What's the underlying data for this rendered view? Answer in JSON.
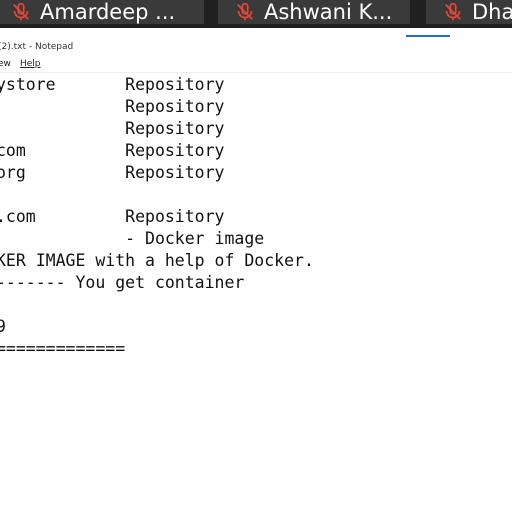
{
  "taskbar": {
    "tiles": [
      {
        "name": "Amardeep ..."
      },
      {
        "name": "Ashwani K..."
      },
      {
        "name": "Dha"
      }
    ],
    "accent_color": "#1e6fd0",
    "mic_color": "#e0453a"
  },
  "window": {
    "title": "(2).txt - Notepad",
    "menu": {
      "view": "ew",
      "help": "Help"
    }
  },
  "editor": {
    "lines": [
      "ystore       Repository",
      "             Repository",
      "             Repository",
      "com          Repository",
      "org          Repository",
      "",
      ".com         Repository",
      "             - Docker image",
      "KER IMAGE with a help of Docker.",
      "------- You get container",
      "",
      "9",
      "============="
    ]
  }
}
